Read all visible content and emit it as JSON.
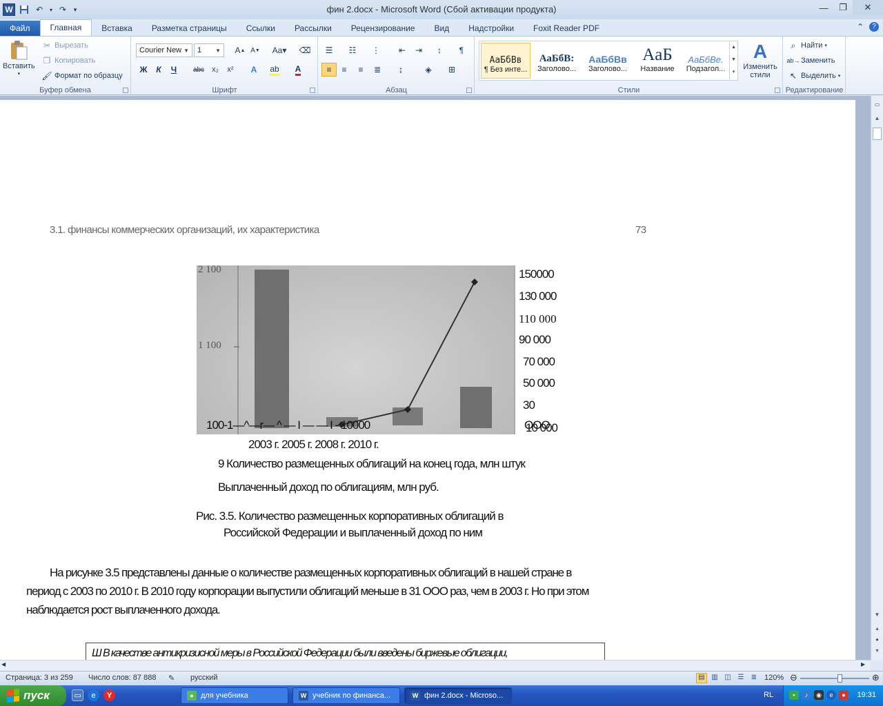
{
  "window": {
    "title": "фин 2.docx  -  Microsoft Word (Сбой активации продукта)",
    "app_icon": "W"
  },
  "tabs": [
    {
      "label": "Файл"
    },
    {
      "label": "Главная"
    },
    {
      "label": "Вставка"
    },
    {
      "label": "Разметка страницы"
    },
    {
      "label": "Ссылки"
    },
    {
      "label": "Рассылки"
    },
    {
      "label": "Рецензирование"
    },
    {
      "label": "Вид"
    },
    {
      "label": "Надстройки"
    },
    {
      "label": "Foxit Reader PDF"
    }
  ],
  "ribbon": {
    "clipboard": {
      "label": "Буфер обмена",
      "paste": "Вставить",
      "cut": "Вырезать",
      "copy": "Копировать",
      "format_painter": "Формат по образцу"
    },
    "font": {
      "label": "Шрифт",
      "font_name": "Courier New",
      "font_size": "1",
      "bold": "Ж",
      "italic": "К",
      "underline": "Ч",
      "strike": "abc",
      "case": "Aa"
    },
    "paragraph": {
      "label": "Абзац"
    },
    "styles": {
      "label": "Стили",
      "items": [
        {
          "sample": "АаБбВв",
          "name": "¶ Без инте..."
        },
        {
          "sample": "АаБбВ:",
          "name": "Заголово..."
        },
        {
          "sample": "АаБбВв",
          "name": "Заголово..."
        },
        {
          "sample": "AaБ",
          "name": "Название"
        },
        {
          "sample": "АаБбВе.",
          "name": "Подзагол..."
        }
      ],
      "change_styles": "Изменить стили"
    },
    "editing": {
      "label": "Редактирование",
      "find": "Найти",
      "replace": "Заменить",
      "select": "Выделить"
    }
  },
  "document": {
    "running_header": "3.1. финансы коммерческих организаций, их характеристика",
    "page_number": "73",
    "right_axis_labels": [
      "150000",
      "130 000",
      "110  000",
      "90 000",
      "70  000",
      "50  000",
      "30",
      "10 000"
    ],
    "left_axis_labels": [
      "2 100",
      "1 100"
    ],
    "axis_baseline_text": "100-1—^—r—     ^       —     I       —   —   I   -   10000",
    "axis_baseline_suffix": "ООО",
    "year_labels": "2003 г. 2005 г. 2008 г. 2010 г.",
    "legend_1": "9  Количество  размещенных  облигаций  на  конец  года,  млн  штук",
    "legend_2": "Выплаченный доход по облигациям, млн руб.",
    "caption_1": "Рис. 3.5. Количество размещенных корпоративных облигаций в",
    "caption_2": "Российской Федерации и выплаченный доход по ним",
    "para_1": "На рисунке 3.5 представлены данные о количестве размещенных корпоративных облигаций в нашей стране в",
    "para_2": "период с 2003 по 2010 г. В 2010 году корпорации выпустили облигаций меньше в 31 ООО раз, чем в 2003 г. Но при этом",
    "para_3": "наблюдается рост выплаченного дохода.",
    "boxed_text": "Ш В качестве антикризисной меры в Российской Федерации были введены биржевые облигации,"
  },
  "status": {
    "page": "Страница: 3 из 259",
    "words": "Число слов: 87 888",
    "language": "русский",
    "zoom": "120%",
    "zoom_fraction": 0.6
  },
  "taskbar": {
    "start": "пуск",
    "tasks": [
      {
        "label": "для учебника"
      },
      {
        "label": "учебник по финанса..."
      },
      {
        "label": "фин 2.docx - Microso..."
      }
    ],
    "lang": "RL",
    "clock": "19:31"
  },
  "colors": {
    "ribbon_accent": "#1d5aa8",
    "taskbar": "#2456c1",
    "start": "#2f8a2e",
    "tray": "#0f6fd0"
  }
}
